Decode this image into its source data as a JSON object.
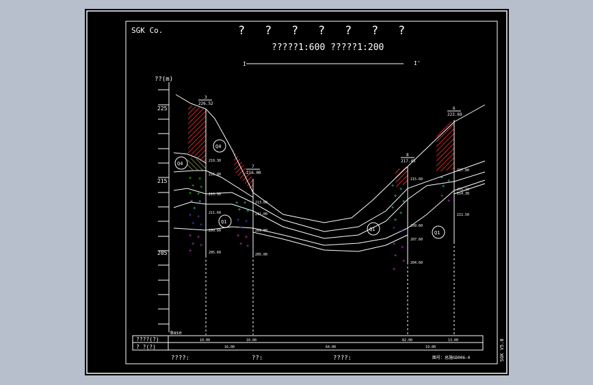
{
  "company": "SGK Co.",
  "title_glyphs": [
    "?",
    "?",
    "?",
    "?",
    "?",
    "?",
    "?"
  ],
  "scale_text": "?????1:600  ?????1:200",
  "profile_mark_left": "I",
  "profile_mark_right": "I'",
  "axis": {
    "label": "??(m)",
    "ticks": [
      "225",
      "215",
      "205"
    ],
    "base_label": "Base"
  },
  "boreholes": [
    {
      "id": "3",
      "elev": "226.52"
    },
    {
      "id": "7",
      "elev": "216.00"
    },
    {
      "id": "8",
      "elev": "217.45"
    },
    {
      "id": "6",
      "elev": "223.69"
    }
  ],
  "layer_depths": {
    "bh3": [
      "219.30",
      "216.80",
      "213.30",
      "211.60",
      "209.60",
      "205.60"
    ],
    "bh7": [
      "213.60",
      "211.00",
      "209.00",
      "205.00"
    ],
    "bh8": [
      "215.60",
      "209.60",
      "207.60",
      "204.60"
    ],
    "bh6": [
      "217.00",
      "215.10",
      "214.30",
      "211.50"
    ]
  },
  "layer_marks": [
    "Q4",
    "Q4",
    "Q1",
    "Q1",
    "Q1"
  ],
  "footer": {
    "row1_label": "????(?)",
    "row2_label": "?    ?(?)",
    "row1_values": [
      "10.00",
      "10.00",
      "82.00",
      "13.00"
    ],
    "row2_values": [
      "16.00",
      "64.00",
      "19.00"
    ],
    "bottom_labels": [
      "????:",
      "??:",
      "????:",
      "图号：总施GD006-4"
    ]
  },
  "side_label": "SGK V5.0",
  "colors": {
    "hatch": "#d42a2a",
    "green": "#22dd22",
    "cyan": "#22dddd",
    "blue": "#3355ff",
    "magenta": "#dd33dd"
  }
}
